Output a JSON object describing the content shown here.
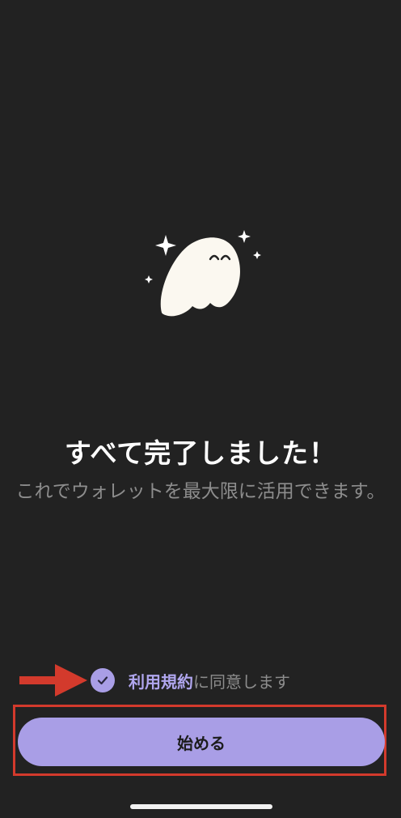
{
  "onboarding": {
    "illustration": "ghost-with-sparkles-icon",
    "title": "すべて完了しました！",
    "subtitle": "これでウォレットを最大限に活用できます。"
  },
  "terms": {
    "checked": true,
    "check_icon": "checkmark-icon",
    "link_label": "利用規約",
    "suffix_label": "に同意します"
  },
  "actions": {
    "start_label": "始める"
  },
  "annotations": {
    "arrow_icon": "red-arrow-icon",
    "highlight_color": "#d33a2c"
  },
  "colors": {
    "background": "#222222",
    "accent": "#a99ee6",
    "text_primary": "#ffffff",
    "text_secondary": "#8d8d8d"
  }
}
